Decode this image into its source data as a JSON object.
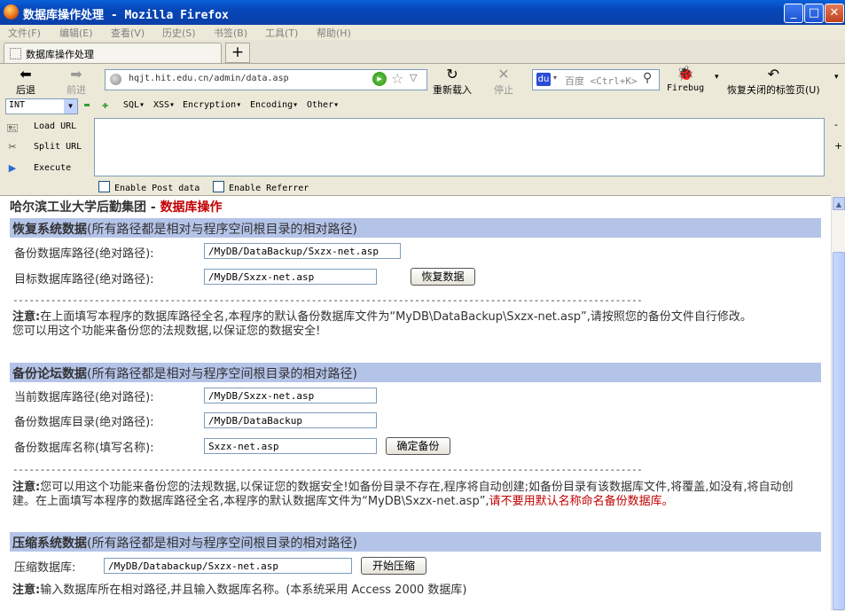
{
  "window": {
    "title": "数据库操作处理 - Mozilla Firefox"
  },
  "menu": [
    "文件(F)",
    "编辑(E)",
    "查看(V)",
    "历史(S)",
    "书签(B)",
    "工具(T)",
    "帮助(H)"
  ],
  "tab": {
    "label": "数据库操作处理",
    "new_tab": "+"
  },
  "nav": {
    "back": "后退",
    "forward": "前进",
    "reload": "重新载入",
    "stop": "停止",
    "url": "hqjt.hit.edu.cn/admin/data.asp",
    "search_placeholder": "百度 <Ctrl+K>",
    "firebug": "Firebug",
    "restore_tabs": "恢复关闭的标签页(U)"
  },
  "hackbar": {
    "type": "INT",
    "menus": [
      "SQL▾",
      "XSS▾",
      "Encryption▾",
      "Encoding▾",
      "Other▾"
    ],
    "load_url": "Load URL",
    "split_url": "Split URL",
    "execute": "Execute",
    "post": "Enable Post data",
    "referrer": "Enable Referrer",
    "minus": "-",
    "plus": "+"
  },
  "page": {
    "org": "哈尔滨工业大学后勤集团",
    "sep": " - ",
    "title": "数据库操作",
    "restore": {
      "heading": "恢复系统数据",
      "hint": "(所有路径都是相对与程序空间根目录的相对路径)",
      "backup_label": "备份数据库路径(绝对路径):",
      "backup_value": "/MyDB/DataBackup/Sxzx-net.asp",
      "target_label": "目标数据库路径(绝对路径):",
      "target_value": "/MyDB/Sxzx-net.asp",
      "button": "恢复数据",
      "dashes": "--------------------------------------------------------------------------------------------------------------------",
      "note_bold": "注意:",
      "note_text": "在上面填写本程序的数据库路径全名,本程序的默认备份数据库文件为“MyDB\\DataBackup\\Sxzx-net.asp”,请按照您的备份文件自行修改。",
      "note_line2": "您可以用这个功能来备份您的法规数据,以保证您的数据安全!"
    },
    "backup": {
      "heading": "备份论坛数据",
      "hint": "(所有路径都是相对与程序空间根目录的相对路径)",
      "current_label": "当前数据库路径(绝对路径):",
      "current_value": "/MyDB/Sxzx-net.asp",
      "dir_label": "备份数据库目录(绝对路径):",
      "dir_value": "/MyDB/DataBackup",
      "name_label": "备份数据库名称(填写名称):",
      "name_value": "Sxzx-net.asp",
      "button": "确定备份",
      "dashes": "--------------------------------------------------------------------------------------------------------------------",
      "note_bold": "注意:",
      "note_text": "您可以用这个功能来备份您的法规数据,以保证您的数据安全!如备份目录不存在,程序将自动创建;如备份目录有该数据库文件,将覆盖,如没有,将自动创建。在上面填写本程序的数据库路径全名,本程序的默认数据库文件为“MyDB\\Sxzx-net.asp”,",
      "note_red": "请不要用默认名称命名备份数据库。"
    },
    "compress": {
      "heading": "压缩系统数据",
      "hint": "(所有路径都是相对与程序空间根目录的相对路径)",
      "label": "压缩数据库:",
      "value": "/MyDB/Databackup/Sxzx-net.asp",
      "button": "开始压缩",
      "note_bold": "注意:",
      "note_text": "输入数据库所在相对路径,并且输入数据库名称。(本系统采用 Access 2000 数据库)"
    }
  }
}
